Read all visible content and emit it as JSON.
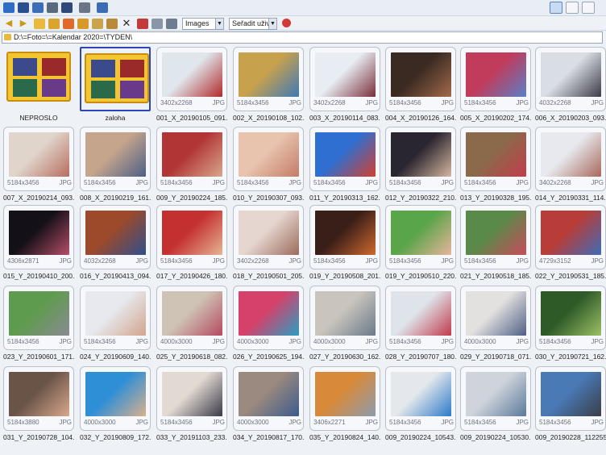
{
  "toolbar": {
    "type_filter": "Images",
    "sort": "Seřadit uživat"
  },
  "path": "D:\\=Foto=\\=Kalendar 2020=\\TYDEN\\",
  "items": [
    {
      "name": "NEPROSLO",
      "kind": "folder",
      "selected": false
    },
    {
      "name": "zaloha",
      "kind": "folder",
      "selected": true
    },
    {
      "name": "001_X_20190105_091...",
      "dims": "3402x2268",
      "fmt": "JPG",
      "colors": [
        "#dfe6ec",
        "#b12a2a"
      ]
    },
    {
      "name": "002_X_20190108_102...",
      "dims": "5184x3456",
      "fmt": "JPG",
      "colors": [
        "#c8a14d",
        "#3d79b6"
      ]
    },
    {
      "name": "003_X_20190114_083...",
      "dims": "3402x2268",
      "fmt": "JPG",
      "colors": [
        "#e8edf3",
        "#7a2e3a"
      ]
    },
    {
      "name": "004_X_20190126_164...",
      "dims": "5184x3456",
      "fmt": "JPG",
      "colors": [
        "#3a2a22",
        "#a26a4a"
      ]
    },
    {
      "name": "005_X_20190202_174...",
      "dims": "5184x3456",
      "fmt": "JPG",
      "colors": [
        "#c13b5a",
        "#5a80c8"
      ]
    },
    {
      "name": "006_X_20190203_093...",
      "dims": "4032x2268",
      "fmt": "JPG",
      "colors": [
        "#d9dde4",
        "#3b3b45"
      ]
    },
    {
      "name": "007_X_20190214_093...",
      "dims": "5184x3456",
      "fmt": "JPG",
      "colors": [
        "#e0d5cb",
        "#b86d5e"
      ]
    },
    {
      "name": "008_X_20190219_161...",
      "dims": "5184x3456",
      "fmt": "JPG",
      "colors": [
        "#c6a58d",
        "#4d5f86"
      ]
    },
    {
      "name": "009_Y_20190224_185...",
      "dims": "5184x3456",
      "fmt": "JPG",
      "colors": [
        "#b23535",
        "#d7a88d"
      ]
    },
    {
      "name": "010_Y_20190307_093...",
      "dims": "5184x3456",
      "fmt": "JPG",
      "colors": [
        "#e8c4ae",
        "#c47c67"
      ]
    },
    {
      "name": "011_Y_20190313_162...",
      "dims": "5184x3456",
      "fmt": "JPG",
      "colors": [
        "#2f6fd1",
        "#d2402e"
      ]
    },
    {
      "name": "012_Y_20190322_210...",
      "dims": "5184x3456",
      "fmt": "JPG",
      "colors": [
        "#2a2630",
        "#d7b6a0"
      ]
    },
    {
      "name": "013_Y_20190328_195...",
      "dims": "5184x3456",
      "fmt": "JPG",
      "colors": [
        "#8a6a4a",
        "#c33d4b"
      ]
    },
    {
      "name": "014_Y_20190331_114...",
      "dims": "3402x2268",
      "fmt": "JPG",
      "colors": [
        "#e7e9ee",
        "#a8685a"
      ]
    },
    {
      "name": "015_Y_20190410_200...",
      "dims": "4306x2871",
      "fmt": "JPG",
      "colors": [
        "#141017",
        "#b64e68"
      ]
    },
    {
      "name": "016_Y_20190413_094...",
      "dims": "4032x2268",
      "fmt": "JPG",
      "colors": [
        "#9c4a2a",
        "#2f4f8c"
      ]
    },
    {
      "name": "017_Y_20190426_180...",
      "dims": "5184x3456",
      "fmt": "JPG",
      "colors": [
        "#c43030",
        "#e6b594"
      ]
    },
    {
      "name": "018_Y_20190501_205...",
      "dims": "3402x2268",
      "fmt": "JPG",
      "colors": [
        "#e5d6cf",
        "#9b6a5b"
      ]
    },
    {
      "name": "019_Y_20190508_201...",
      "dims": "5184x3456",
      "fmt": "JPG",
      "colors": [
        "#3a1e18",
        "#cf6a2e"
      ]
    },
    {
      "name": "019_Y_20190510_220...",
      "dims": "5184x3456",
      "fmt": "JPG",
      "colors": [
        "#58a54a",
        "#e8b49a"
      ]
    },
    {
      "name": "021_Y_20190518_185...",
      "dims": "5184x3456",
      "fmt": "JPG",
      "colors": [
        "#5a8a4a",
        "#c94a5a"
      ]
    },
    {
      "name": "022_Y_20190531_185...",
      "dims": "4729x3152",
      "fmt": "JPG",
      "colors": [
        "#b83d38",
        "#3e6cb8"
      ]
    },
    {
      "name": "023_Y_20190601_171...",
      "dims": "5184x3456",
      "fmt": "JPG",
      "colors": [
        "#5f9b4e",
        "#8a8a94"
      ]
    },
    {
      "name": "024_Y_20190609_140...",
      "dims": "5184x3456",
      "fmt": "JPG",
      "colors": [
        "#e7e9ef",
        "#d2a48c"
      ]
    },
    {
      "name": "025_Y_20190618_082...",
      "dims": "4000x3000",
      "fmt": "JPG",
      "colors": [
        "#cfc3b5",
        "#b44a60"
      ]
    },
    {
      "name": "026_Y_20190625_194...",
      "dims": "4000x3000",
      "fmt": "JPG",
      "colors": [
        "#d5416a",
        "#2a9fc4"
      ]
    },
    {
      "name": "027_Y_20190630_162...",
      "dims": "4000x3000",
      "fmt": "JPG",
      "colors": [
        "#c9c4bd",
        "#6a7a8a"
      ]
    },
    {
      "name": "028_Y_20190707_180...",
      "dims": "5184x3456",
      "fmt": "JPG",
      "colors": [
        "#dfe3ea",
        "#c03a4a"
      ]
    },
    {
      "name": "029_Y_20190718_071...",
      "dims": "4000x3000",
      "fmt": "JPG",
      "colors": [
        "#e3e1df",
        "#4e5f86"
      ]
    },
    {
      "name": "030_Y_20190721_162...",
      "dims": "5184x3456",
      "fmt": "JPG",
      "colors": [
        "#2e5a28",
        "#9cc064"
      ]
    },
    {
      "name": "031_Y_20190728_104...",
      "dims": "5184x3880",
      "fmt": "JPG",
      "colors": [
        "#6a5448",
        "#d9a88c"
      ]
    },
    {
      "name": "032_Y_20190809_172...",
      "dims": "4000x3000",
      "fmt": "JPG",
      "colors": [
        "#2f8fd6",
        "#d9b08c"
      ]
    },
    {
      "name": "033_Y_20191103_233...",
      "dims": "5184x3456",
      "fmt": "JPG",
      "colors": [
        "#e2d9d2",
        "#3a3a48"
      ]
    },
    {
      "name": "034_Y_20190817_170...",
      "dims": "4000x3000",
      "fmt": "JPG",
      "colors": [
        "#9a8a80",
        "#3d5a8c"
      ]
    },
    {
      "name": "035_Y_20190824_140...",
      "dims": "3406x2271",
      "fmt": "JPG",
      "colors": [
        "#d88a3a",
        "#8c9cae"
      ]
    },
    {
      "name": "009_20190224_10543...",
      "dims": "5184x3456",
      "fmt": "JPG",
      "colors": [
        "#e4e7ec",
        "#2b7ac8"
      ]
    },
    {
      "name": "009_20190224_10530...",
      "dims": "5184x3456",
      "fmt": "JPG",
      "colors": [
        "#cfd4dc",
        "#5a7a9a"
      ]
    },
    {
      "name": "009_20190228_112255...",
      "dims": "5184x3456",
      "fmt": "JPG",
      "colors": [
        "#4a7ab6",
        "#3a3e4a"
      ]
    }
  ]
}
